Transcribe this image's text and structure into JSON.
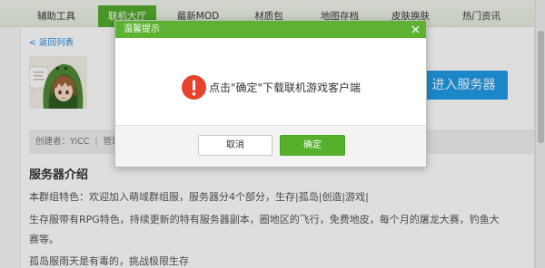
{
  "nav": {
    "tabs": [
      {
        "label": "辅助工具"
      },
      {
        "label": "联机大厅",
        "active": true
      },
      {
        "label": "最新MOD"
      },
      {
        "label": "材质包"
      },
      {
        "label": "地图存档"
      },
      {
        "label": "皮肤换肤"
      },
      {
        "label": "热门资讯"
      }
    ]
  },
  "back_link": {
    "arrow": "<",
    "label": "返回列表"
  },
  "server": {
    "enter_button": "进入服务器",
    "creator": "创建者：YiCC",
    "separator": "|",
    "admin": "管理"
  },
  "intro": {
    "heading": "服务器介绍",
    "paragraphs": [
      "本群组特色：欢迎加入萌域群组服，服务器分4个部分，生存|孤岛|创造|游戏|",
      "生存服带有RPG特色，持续更新的特有服务器副本，圈地区的飞行，免费地皮，每个月的屠龙大赛，钓鱼大赛等。",
      "孤岛服雨天是有毒的，挑战极限生存"
    ]
  },
  "dialog": {
    "title": "温馨提示",
    "message": "点击\"确定\"下载联机游戏客户端",
    "cancel_label": "取消",
    "confirm_label": "确定"
  },
  "icons": {
    "back": "back-arrow-icon",
    "dialog_close": "close-icon",
    "dialog_warning": "warning-icon"
  },
  "colors": {
    "nav_active": "#54ad2c",
    "link": "#2b88d8",
    "enter_button": "#1f9ae6",
    "meta_bar": "#efefef",
    "dialog_title_bar": "#5db233",
    "confirm_button": "#56b02b",
    "warning_icon": "#e5432c"
  }
}
